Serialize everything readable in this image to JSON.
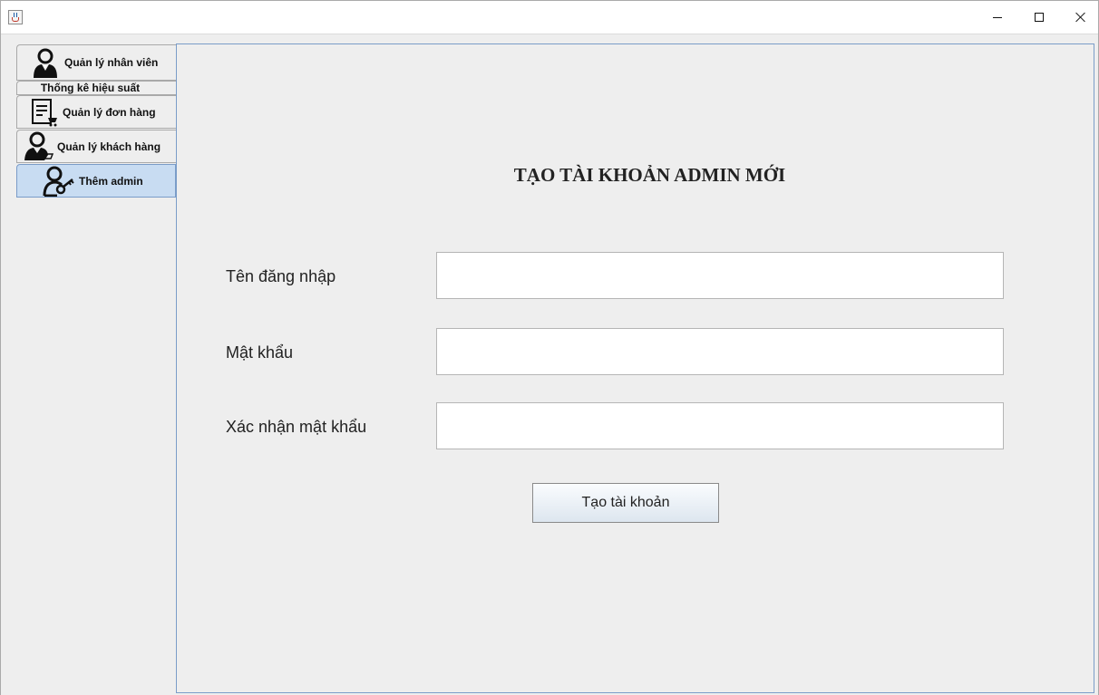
{
  "window": {
    "controls": {
      "minimize_icon": "minimize-icon",
      "maximize_icon": "maximize-icon",
      "close_icon": "close-icon"
    },
    "app_icon": "java-cup-icon"
  },
  "tabs": [
    {
      "label": "Quản lý nhân viên",
      "icon": "employee-icon"
    },
    {
      "label": "Thống kê hiệu suất",
      "icon": ""
    },
    {
      "label": "Quản lý đơn hàng",
      "icon": "order-list-icon"
    },
    {
      "label": "Quản lý khách hàng",
      "icon": "customer-icon"
    },
    {
      "label": "Thêm admin",
      "icon": "admin-key-icon",
      "selected": true
    }
  ],
  "form": {
    "title": "TẠO TÀI KHOẢN ADMIN MỚI",
    "fields": [
      {
        "label": "Tên đăng nhập",
        "value": ""
      },
      {
        "label": "Mật khẩu",
        "value": ""
      },
      {
        "label": "Xác nhận mật khẩu",
        "value": ""
      }
    ],
    "submit_label": "Tạo tài khoản"
  },
  "colors": {
    "selected_tab": "#c8dcf2",
    "panel_border": "#7a9cc8",
    "background": "#eeeeee"
  }
}
